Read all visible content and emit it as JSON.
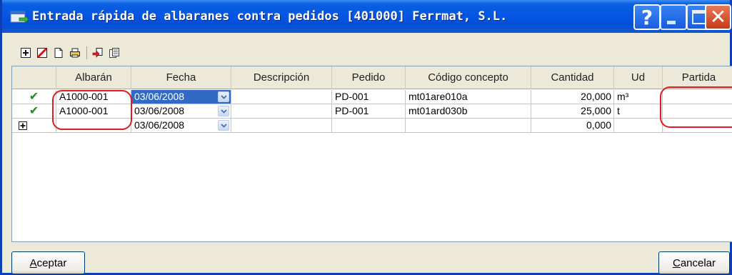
{
  "window": {
    "title": "Entrada rápida de albaranes contra pedidos [401000] Ferrmat, S.L.",
    "help_symbol": "?",
    "close_symbol": "✕"
  },
  "toolbar": {
    "items": [
      {
        "name": "new-line-icon"
      },
      {
        "name": "delete-icon"
      },
      {
        "name": "copy-icon"
      },
      {
        "name": "print-icon"
      },
      {
        "name": "import-icon"
      },
      {
        "name": "properties-icon"
      }
    ]
  },
  "grid": {
    "columns": [
      "",
      "Albarán",
      "Fecha",
      "Descripción",
      "Pedido",
      "Código concepto",
      "Cantidad",
      "Ud",
      "Partida"
    ],
    "rows": [
      {
        "status": "✔",
        "albaran": "A1000-001",
        "fecha": "03/06/2008",
        "descripcion": "",
        "pedido": "PD-001",
        "codigo": "mt01are010a",
        "cantidad": "20,000",
        "ud": "m³",
        "partida": ""
      },
      {
        "status": "✔",
        "albaran": "A1000-001",
        "fecha": "03/06/2008",
        "descripcion": "",
        "pedido": "PD-001",
        "codigo": "mt01ard030b",
        "cantidad": "25,000",
        "ud": "t",
        "partida": ""
      },
      {
        "status": "",
        "albaran": "",
        "fecha": "03/06/2008",
        "descripcion": "",
        "pedido": "",
        "codigo": "",
        "cantidad": "0,000",
        "ud": "",
        "partida": ""
      }
    ]
  },
  "buttons": {
    "accept": {
      "prefix": "",
      "accel": "A",
      "rest": "ceptar"
    },
    "cancel": {
      "prefix": "",
      "accel": "C",
      "rest": "ancelar"
    }
  },
  "colors": {
    "title_bar": "#0656e6",
    "selection": "#316ac5",
    "highlight_ovals": "#e31b23",
    "check": "#1f8a1f"
  }
}
